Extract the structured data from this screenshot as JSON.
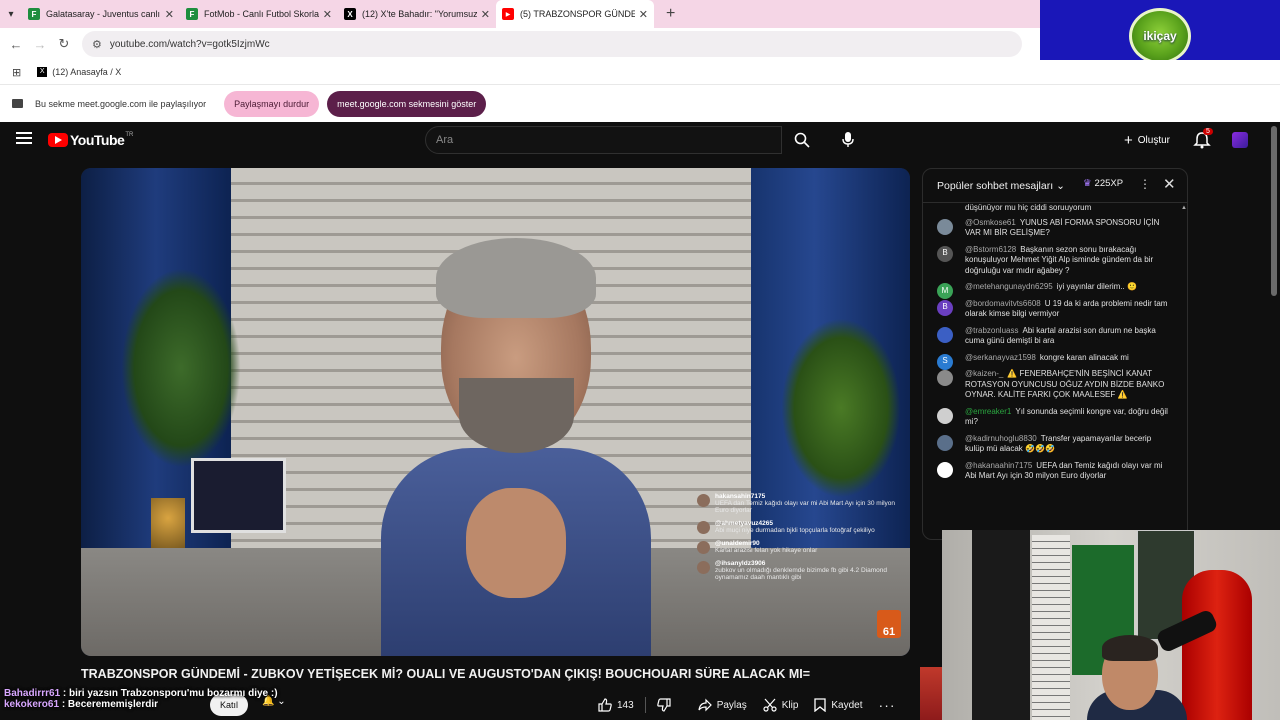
{
  "browser": {
    "tabs": [
      {
        "title": "Galatasaray - Juventus canlı sko",
        "fav_color": "#1e8e3e",
        "fav_glyph": "F"
      },
      {
        "title": "FotMob - Canlı Futbol Skorları",
        "fav_color": "#1e8e3e",
        "fav_glyph": "F"
      },
      {
        "title": "(12) X'te Bahadır: \"Yorumsuz...",
        "fav_color": "#000000",
        "fav_glyph": "X"
      },
      {
        "title": "(5) TRABZONSPOR GÜNDEM",
        "fav_color": "#ff0000",
        "fav_glyph": "▶"
      }
    ],
    "url": "youtube.com/watch?v=gotk5IzjmWc",
    "bookmark": "(12) Anasayfa / X",
    "share_text": "Bu sekme meet.google.com ile paylaşılıyor",
    "stop_share": "Paylaşmayı durdur",
    "show_meet_tab": "meet.google.com sekmesini göster",
    "logo_text": "ikiçay"
  },
  "youtube": {
    "logo_word": "YouTube",
    "logo_country": "TR",
    "search_placeholder": "Ara",
    "create_label": "Oluştur",
    "notif_count": "5",
    "video_title": "TRABZONSPOR GÜNDEMİ - ZUBKOV YETİŞECEK Mİ? OUALI VE AUGUSTO'DAN ÇIKIŞ! BOUCHOUARI SÜRE ALACAK MI=",
    "ticker": [
      {
        "user": "Bahadirrr61",
        "text": ": biri yazsın Trabzonsporu'mu bozarmı diye :)"
      },
      {
        "user": "kekokero61",
        "text": ": Becerememişlerdir"
      }
    ],
    "join_label": "Katıl",
    "likes": "143",
    "share_label": "Paylaş",
    "clip_label": "Klip",
    "save_label": "Kaydet",
    "overlay_chat": [
      {
        "user": "hakansahin7175",
        "text": "UEFA dan Temiz kağıdı olayı var mi Abi Mart Ayı için 30 milyon Euro diyorlar"
      },
      {
        "user": "@ahmetyavuz4265",
        "text": "Abi muçi niye durmadan bjkli topçularla fotoğraf çekiliyo"
      },
      {
        "user": "@unaldemir90",
        "text": "Kartal arazisi felan yok hikaye onlar"
      },
      {
        "user": "@ihsanyldz3906",
        "text": "zubkov un olmadığı denklemde bizimde fb gibi 4.2 Diamond oynamamız daah mantıklı gibi"
      }
    ]
  },
  "chat": {
    "header": "Popüler sohbet mesajları",
    "xp": "225XP",
    "cont_line": "düşünüyor mu hiç ciddi soruuyorum",
    "messages": [
      {
        "user": "@Osmkose61",
        "text": "YUNUS ABİ FORMA SPONSORU İÇİN VAR MI BİR GELİŞME?",
        "av_color": "#7a8a99",
        "av": ""
      },
      {
        "user": "@Bstorm6128",
        "text": "Başkanın sezon sonu bırakacağı konuşuluyor Mehmet Yiğit Alp isminde gündem da bir doğruluğu var mıdır ağabey ?",
        "av_color": "#555555",
        "av": "B"
      },
      {
        "user": "@metehangunaydn6295",
        "text": "iyi yayınlar dilerim.. 🙂",
        "av_color": "#3aa357",
        "av": "M"
      },
      {
        "user": "@bordomavitvts6608",
        "text": "U 19 da ki arda problemi nedir tam olarak kimse bilgi vermiyor",
        "av_color": "#6a3fc0",
        "av": "B"
      },
      {
        "user": "@trabzonluass",
        "text": "Abi kartal arazisi son durum ne başka cuma günü demişti bi ara",
        "av_color": "#3b5fc4",
        "av": ""
      },
      {
        "user": "@serkanayvaz1598",
        "text": "kongre karan alinacak mi",
        "av_color": "#2a7bd1",
        "av": "S"
      },
      {
        "user": "@kaizen-_",
        "text": "⚠️ FENERBAHÇE'NİN BEŞİNCİ KANAT ROTASYON OYUNCUSU OĞUZ AYDIN BİZDE BANKO OYNAR. KALİTE FARKI ÇOK MAALESEF ⚠️",
        "av_color": "#8a8a8a",
        "av": ""
      },
      {
        "user": "@emreaker1",
        "text": "Yıl sonunda seçimli kongre var, doğru değil mi?",
        "av_color": "#cfcfcf",
        "av": "",
        "green": true
      },
      {
        "user": "@kadirnuhoglu8830",
        "text": "Transfer yapamayanlar becerip kulüp mü alacak 🤣🤣🤣",
        "av_color": "#5a6f8a",
        "av": ""
      },
      {
        "user": "@hakanaahin7175",
        "text": "UEFA dan Temiz kağıdı olayı var mi Abi Mart Ayı için 30 milyon Euro diyorlar",
        "av_color": "#ffffff",
        "av": ""
      }
    ]
  }
}
